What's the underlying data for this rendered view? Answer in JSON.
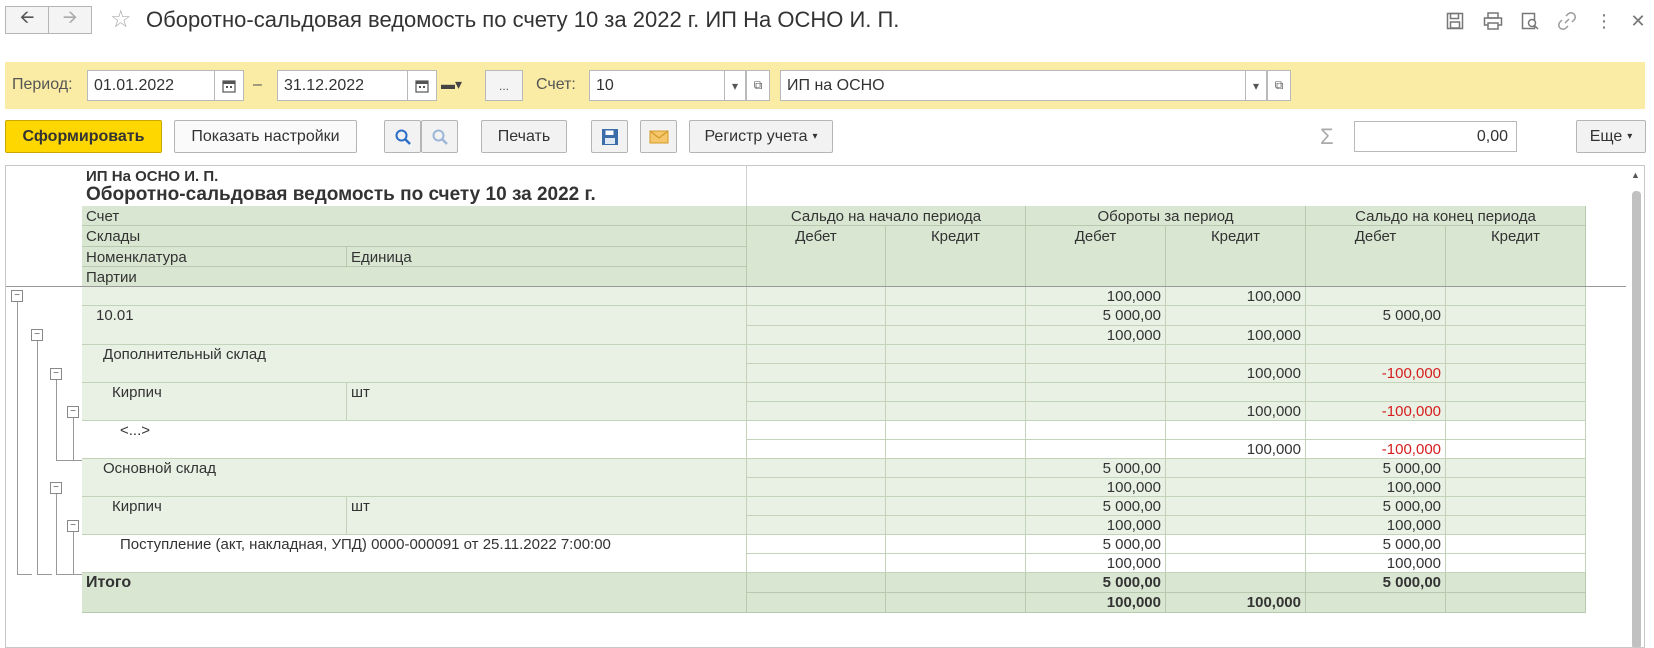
{
  "window": {
    "title": "Оборотно-сальдовая ведомость по счету 10 за 2022 г. ИП На ОСНО И. П."
  },
  "icons": {
    "back": "arrow-left-icon",
    "forward": "arrow-right-icon",
    "star": "star-icon",
    "save": "floppy-icon",
    "print": "printer-icon",
    "preview": "preview-icon",
    "link": "link-icon",
    "more": "kebab-icon",
    "close": "close-icon"
  },
  "filters": {
    "period_label": "Период:",
    "date_from": "01.01.2022",
    "dash": "–",
    "date_to": "31.12.2022",
    "dots": "...",
    "account_label": "Счет:",
    "account": "10",
    "org": "ИП на ОСНО"
  },
  "toolbar": {
    "generate": "Сформировать",
    "show_settings": "Показать настройки",
    "print": "Печать",
    "register": "Регистр учета",
    "sum_value": "0,00",
    "more": "Еще"
  },
  "report": {
    "org": "ИП На ОСНО И. П.",
    "title": "Оборотно-сальдовая ведомость по счету 10 за 2022 г.",
    "headers": {
      "account": "Счет",
      "warehouses": "Склады",
      "nomenclature": "Номенклатура",
      "unit": "Единица",
      "batches": "Партии",
      "opening": "Сальдо на начало периода",
      "turnover": "Обороты за период",
      "closing": "Сальдо на конец периода",
      "debit": "Дебет",
      "credit": "Кредит"
    },
    "rows": [
      {
        "label": "",
        "unit": "",
        "od": "",
        "oc": "",
        "td": "100,000",
        "tc": "100,000",
        "cd": "",
        "cc": ""
      },
      {
        "label": "10.01",
        "unit": "",
        "od": "",
        "oc": "",
        "td": "5 000,00",
        "tc": "",
        "cd": "5 000,00",
        "cc": ""
      },
      {
        "label": "",
        "unit": "",
        "od": "",
        "oc": "",
        "td": "100,000",
        "tc": "100,000",
        "cd": "",
        "cc": ""
      },
      {
        "label": "Дополнительный склад",
        "unit": "",
        "od": "",
        "oc": "",
        "td": "",
        "tc": "",
        "cd": "",
        "cc": ""
      },
      {
        "label": "",
        "unit": "",
        "od": "",
        "oc": "",
        "td": "",
        "tc": "100,000",
        "cd": "-100,000",
        "cc": ""
      },
      {
        "label": "Кирпич",
        "unit": "шт",
        "od": "",
        "oc": "",
        "td": "",
        "tc": "",
        "cd": "",
        "cc": ""
      },
      {
        "label": "",
        "unit": "",
        "od": "",
        "oc": "",
        "td": "",
        "tc": "100,000",
        "cd": "-100,000",
        "cc": ""
      },
      {
        "label": "<...>",
        "unit": "",
        "od": "",
        "oc": "",
        "td": "",
        "tc": "",
        "cd": "",
        "cc": ""
      },
      {
        "label": "",
        "unit": "",
        "od": "",
        "oc": "",
        "td": "",
        "tc": "100,000",
        "cd": "-100,000",
        "cc": ""
      },
      {
        "label": "Основной склад",
        "unit": "",
        "od": "",
        "oc": "",
        "td": "5 000,00",
        "tc": "",
        "cd": "5 000,00",
        "cc": ""
      },
      {
        "label": "",
        "unit": "",
        "od": "",
        "oc": "",
        "td": "100,000",
        "tc": "",
        "cd": "100,000",
        "cc": ""
      },
      {
        "label": "Кирпич",
        "unit": "шт",
        "od": "",
        "oc": "",
        "td": "5 000,00",
        "tc": "",
        "cd": "5 000,00",
        "cc": ""
      },
      {
        "label": "",
        "unit": "",
        "od": "",
        "oc": "",
        "td": "100,000",
        "tc": "",
        "cd": "100,000",
        "cc": ""
      },
      {
        "label": "Поступление (акт, накладная, УПД) 0000-000091 от 25.11.2022 7:00:00",
        "unit": "",
        "od": "",
        "oc": "",
        "td": "5 000,00",
        "tc": "",
        "cd": "5 000,00",
        "cc": ""
      },
      {
        "label": "",
        "unit": "",
        "od": "",
        "oc": "",
        "td": "100,000",
        "tc": "",
        "cd": "100,000",
        "cc": ""
      }
    ],
    "total": {
      "label": "Итого",
      "row1": {
        "td": "5 000,00",
        "tc": "",
        "cd": "5 000,00"
      },
      "row2": {
        "td": "100,000",
        "tc": "100,000",
        "cd": ""
      }
    }
  }
}
